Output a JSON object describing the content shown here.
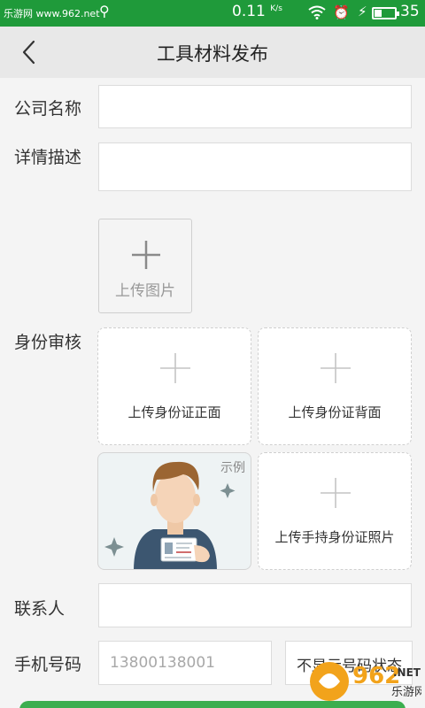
{
  "status_bar": {
    "watermark": "乐游网 www.962.net",
    "network_speed": "0.11",
    "speed_unit": "K/s",
    "battery_level": "35",
    "battery_fraction": 0.35
  },
  "header": {
    "title": "工具材料发布"
  },
  "form": {
    "company_label": "公司名称",
    "company_value": "",
    "detail_label": "详情描述",
    "detail_value": "",
    "upload_image_label": "上传图片",
    "identity_label": "身份审核",
    "id_front_label": "上传身份证正面",
    "id_back_label": "上传身份证背面",
    "example_tag": "示例",
    "id_handheld_label": "上传手持身份证照片",
    "contact_label": "联系人",
    "contact_value": "",
    "phone_label": "手机号码",
    "phone_placeholder": "13800138001",
    "hide_number_label": "不显示号码状态"
  },
  "watermark": {
    "brand": "962",
    "suffix": ".NET",
    "site": "乐游网"
  },
  "colors": {
    "status_bar": "#1f9a3a",
    "nav_bar": "#e8e8e8",
    "background": "#f4f4f4",
    "accent_green": "#3cae4f"
  }
}
